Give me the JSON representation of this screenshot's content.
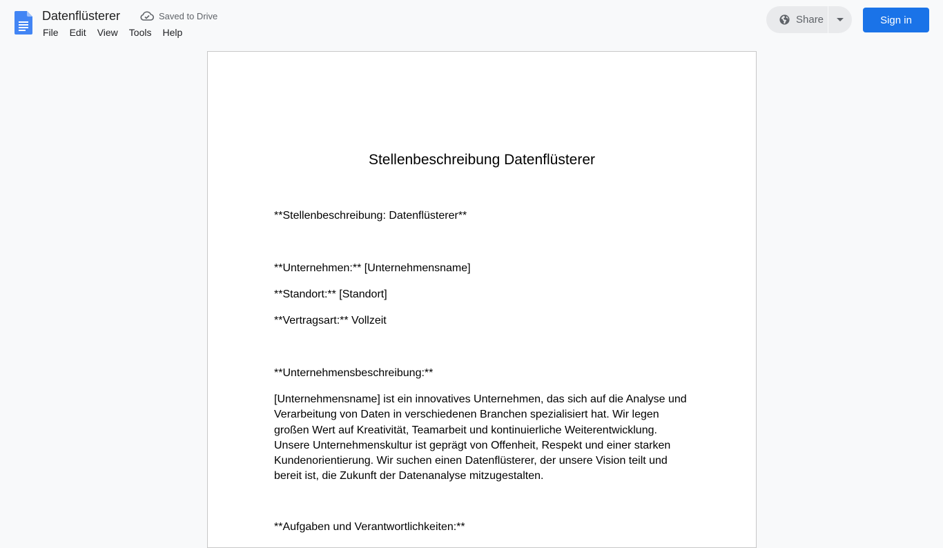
{
  "header": {
    "app_icon": "google-docs-icon",
    "doc_title": "Datenflüsterer",
    "save_status_icon": "cloud-check-icon",
    "save_status": "Saved to Drive",
    "menu": [
      "File",
      "Edit",
      "View",
      "Tools",
      "Help"
    ],
    "share_icon": "globe-icon",
    "share_label": "Share",
    "share_dropdown_icon": "caret-down-icon",
    "signin_label": "Sign in"
  },
  "colors": {
    "accent": "#1a73e8",
    "background": "#f8f9fa",
    "page": "#ffffff"
  },
  "document": {
    "heading": "Stellenbeschreibung Datenflüsterer",
    "paragraphs": [
      "**Stellenbeschreibung: Datenflüsterer**",
      "**Unternehmen:** [Unternehmensname]",
      "**Standort:** [Standort]",
      "**Vertragsart:** Vollzeit",
      "**Unternehmensbeschreibung:**",
      "[Unternehmensname] ist ein innovatives Unternehmen, das sich auf die Analyse und Verarbeitung von Daten in verschiedenen Branchen spezialisiert hat. Wir legen großen Wert auf Kreativität, Teamarbeit und kontinuierliche Weiterentwicklung. Unsere Unternehmenskultur ist geprägt von Offenheit, Respekt und einer starken Kundenorientierung. Wir suchen einen Datenflüsterer, der unsere Vision teilt und bereit ist, die Zukunft der Datenanalyse mitzugestalten.",
      "**Aufgaben und Verantwortlichkeiten:**"
    ]
  }
}
